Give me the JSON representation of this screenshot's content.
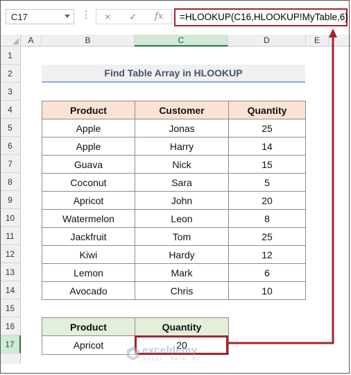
{
  "name_box": "C17",
  "formula_bar": {
    "cancel_icon": "×",
    "enter_icon": "✓",
    "fx_label": "fx",
    "formula": "=HLOOKUP(C16,HLOOKUP!MyTable,6)"
  },
  "columns": [
    "A",
    "B",
    "C",
    "D",
    "E"
  ],
  "rows": [
    "1",
    "2",
    "3",
    "4",
    "5",
    "6",
    "7",
    "8",
    "9",
    "10",
    "11",
    "12",
    "13",
    "14",
    "15",
    "16",
    "17"
  ],
  "title": "Find Table Array in HLOOKUP",
  "main_table": {
    "headers": [
      "Product",
      "Customer",
      "Quantity"
    ],
    "rows": [
      [
        "Apple",
        "Jonas",
        "25"
      ],
      [
        "Apple",
        "Harry",
        "14"
      ],
      [
        "Guava",
        "Nick",
        "15"
      ],
      [
        "Coconut",
        "Sara",
        "5"
      ],
      [
        "Apricot",
        "John",
        "20"
      ],
      [
        "Watermelon",
        "Leon",
        "8"
      ],
      [
        "Jackfruit",
        "Tom",
        "25"
      ],
      [
        "Kiwi",
        "Hardy",
        "12"
      ],
      [
        "Lemon",
        "Mark",
        "6"
      ],
      [
        "Avocado",
        "Chris",
        "10"
      ]
    ]
  },
  "lookup_table": {
    "headers": [
      "Product",
      "Quantity"
    ],
    "values": [
      "Apricot",
      "20"
    ]
  },
  "watermark": {
    "name": "exceldemy",
    "tagline": "EXCEL · DATA · BI"
  },
  "colors": {
    "highlight_red": "#a4232d",
    "header_peach": "#fbe2d5",
    "header_green": "#e2efda",
    "title_text": "#44546a",
    "selected_header": "#217346"
  }
}
